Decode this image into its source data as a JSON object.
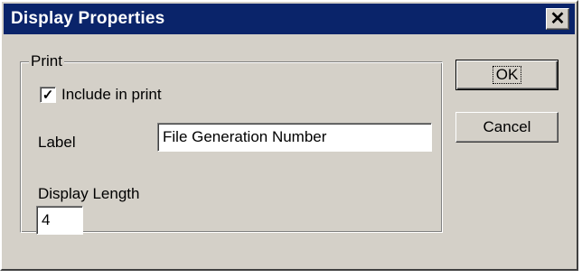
{
  "window": {
    "title": "Display Properties",
    "close_symbol": "✕",
    "title_bar_color": "#0a246a",
    "face_color": "#d4d0c8"
  },
  "print_group": {
    "label": "Print",
    "include_checkbox": {
      "label": "Include in print",
      "checked": true,
      "check_symbol": "✓"
    },
    "label_field": {
      "label": "Label",
      "value": "File Generation Number"
    },
    "display_length_field": {
      "label": "Display Length",
      "value": "4"
    }
  },
  "buttons": {
    "ok": "OK",
    "cancel": "Cancel"
  }
}
